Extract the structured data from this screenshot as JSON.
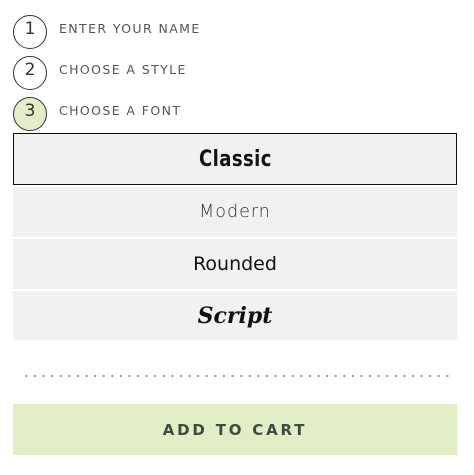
{
  "steps": [
    {
      "number": "1",
      "label": "ENTER YOUR NAME",
      "active": false
    },
    {
      "number": "2",
      "label": "CHOOSE A STYLE",
      "active": false
    },
    {
      "number": "3",
      "label": "CHOOSE A FONT",
      "active": true
    }
  ],
  "font_options": [
    {
      "label": "Classic",
      "selected": true
    },
    {
      "label": "Modern",
      "selected": false
    },
    {
      "label": "Rounded",
      "selected": false
    },
    {
      "label": "Script",
      "selected": false
    }
  ],
  "cart": {
    "button_label": "ADD TO CART"
  },
  "colors": {
    "active_step": "#e1eec5",
    "button_bg": "#e1eec5",
    "option_bg": "#f1f1f1",
    "selected_border": "#111111"
  }
}
